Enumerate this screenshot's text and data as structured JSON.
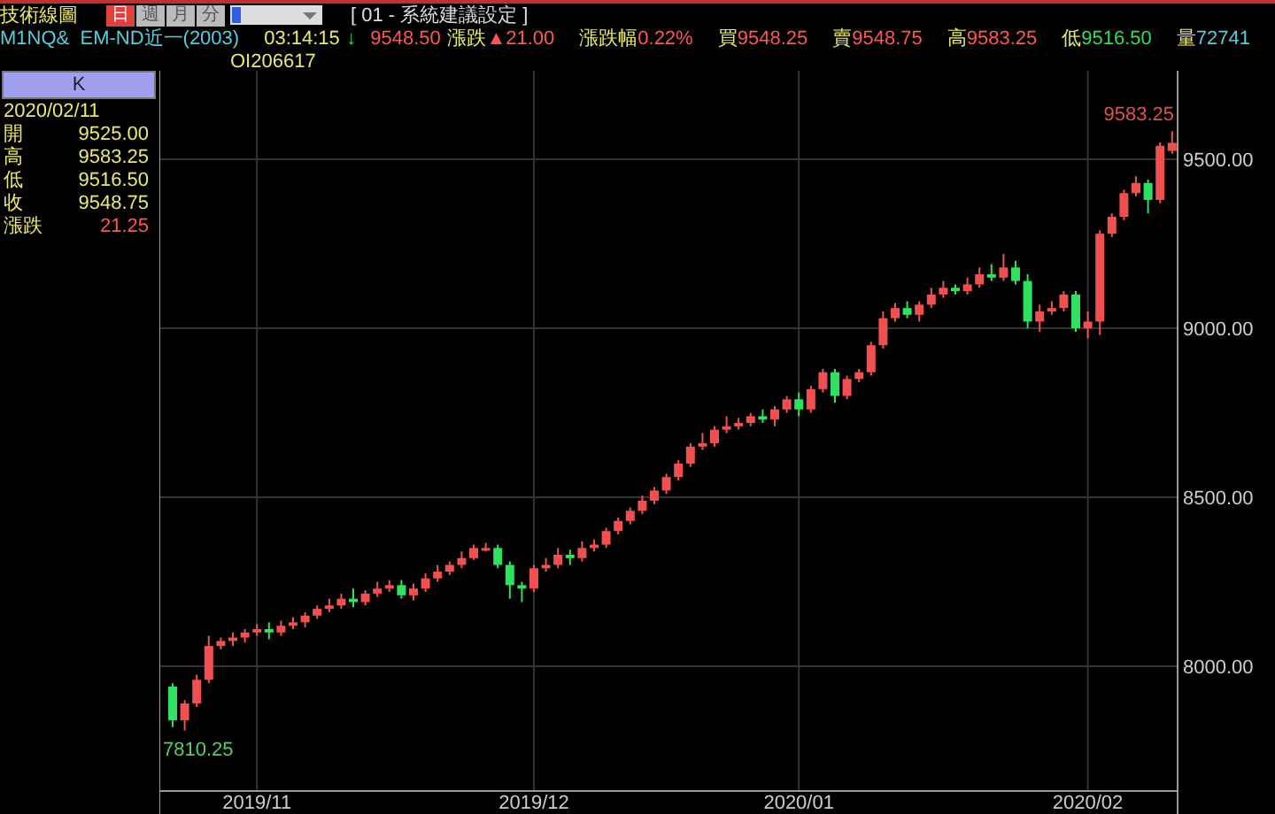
{
  "toolbar": {
    "title": "技術線圖",
    "periods": [
      {
        "label": "日",
        "selected": true
      },
      {
        "label": "週",
        "selected": false
      },
      {
        "label": "月",
        "selected": false
      },
      {
        "label": "分",
        "selected": false
      }
    ],
    "settings": "[ 01 - 系統建議設定 ]"
  },
  "quote": {
    "symbol": "M1NQ&  EM-ND近一(2003)",
    "time": "03:14:15",
    "arrow": "↓",
    "price": "9548.50",
    "items": [
      {
        "label": "漲跌",
        "value": "▲21.00",
        "color": "#ff5555"
      },
      {
        "label": "漲跌幅",
        "value": "0.22%",
        "color": "#ff5555"
      },
      {
        "label": "買",
        "value": "9548.25",
        "color": "#ff5555"
      },
      {
        "label": "賣",
        "value": "9548.75",
        "color": "#ff5555"
      },
      {
        "label": "高",
        "value": "9583.25",
        "color": "#ff5555"
      },
      {
        "label": "低",
        "value": "9516.50",
        "color": "#33dd55"
      },
      {
        "label": "量",
        "value": "72741",
        "color": "#55ccdd"
      }
    ],
    "oi": "OI206617"
  },
  "info": {
    "header": "K",
    "date": "2020/02/11",
    "rows": [
      {
        "label": "開",
        "value": "9525.00",
        "color": "#e8e870"
      },
      {
        "label": "高",
        "value": "9583.25",
        "color": "#e8e870"
      },
      {
        "label": "低",
        "value": "9516.50",
        "color": "#e8e870"
      },
      {
        "label": "收",
        "value": "9548.75",
        "color": "#e8e870"
      },
      {
        "label": "漲跌",
        "value": "21.25",
        "color": "#ff5555"
      }
    ]
  },
  "chart": {
    "high_label": "9583.25",
    "low_label": "7810.25",
    "chart_data": {
      "type": "candlestick",
      "yticks": [
        {
          "value": 9500,
          "label": "9500.00"
        },
        {
          "value": 9000,
          "label": "9000.00"
        },
        {
          "value": 8500,
          "label": "8500.00"
        },
        {
          "value": 8000,
          "label": "8000.00"
        }
      ],
      "ylim": [
        7631,
        9762
      ],
      "grid": true,
      "categories": [
        null,
        null,
        null,
        null,
        null,
        null,
        null,
        "2019/11",
        null,
        null,
        null,
        null,
        null,
        null,
        null,
        null,
        null,
        null,
        null,
        null,
        null,
        null,
        null,
        null,
        null,
        null,
        null,
        null,
        null,
        null,
        "2019/12",
        null,
        null,
        null,
        null,
        null,
        null,
        null,
        null,
        null,
        null,
        null,
        null,
        null,
        null,
        null,
        null,
        null,
        null,
        null,
        null,
        null,
        "2020/01",
        null,
        null,
        null,
        null,
        null,
        null,
        null,
        null,
        null,
        null,
        null,
        null,
        null,
        null,
        null,
        null,
        null,
        null,
        null,
        null,
        null,
        null,
        null,
        "2020/02",
        null,
        null,
        null,
        null,
        null,
        null,
        null
      ],
      "ohlc": [
        [
          7940,
          7950,
          7820,
          7840
        ],
        [
          7840,
          7900,
          7810,
          7890
        ],
        [
          7890,
          7975,
          7880,
          7960
        ],
        [
          7960,
          8090,
          7950,
          8060
        ],
        [
          8060,
          8085,
          8050,
          8075
        ],
        [
          8075,
          8100,
          8060,
          8085
        ],
        [
          8085,
          8110,
          8070,
          8100
        ],
        [
          8100,
          8125,
          8090,
          8110
        ],
        [
          8110,
          8130,
          8080,
          8100
        ],
        [
          8100,
          8135,
          8090,
          8120
        ],
        [
          8120,
          8145,
          8110,
          8130
        ],
        [
          8130,
          8160,
          8115,
          8150
        ],
        [
          8150,
          8180,
          8140,
          8170
        ],
        [
          8170,
          8200,
          8160,
          8180
        ],
        [
          8180,
          8215,
          8170,
          8200
        ],
        [
          8200,
          8230,
          8175,
          8190
        ],
        [
          8190,
          8225,
          8180,
          8215
        ],
        [
          8215,
          8250,
          8205,
          8230
        ],
        [
          8230,
          8255,
          8220,
          8240
        ],
        [
          8240,
          8255,
          8200,
          8210
        ],
        [
          8210,
          8245,
          8195,
          8230
        ],
        [
          8230,
          8275,
          8220,
          8260
        ],
        [
          8260,
          8300,
          8250,
          8280
        ],
        [
          8280,
          8310,
          8270,
          8300
        ],
        [
          8300,
          8340,
          8290,
          8320
        ],
        [
          8320,
          8360,
          8315,
          8350
        ],
        [
          8350,
          8365,
          8340,
          8350
        ],
        [
          8350,
          8360,
          8290,
          8300
        ],
        [
          8300,
          8310,
          8200,
          8240
        ],
        [
          8240,
          8250,
          8190,
          8230
        ],
        [
          8230,
          8300,
          8220,
          8290
        ],
        [
          8290,
          8320,
          8280,
          8300
        ],
        [
          8300,
          8350,
          8290,
          8330
        ],
        [
          8330,
          8345,
          8300,
          8320
        ],
        [
          8320,
          8370,
          8310,
          8350
        ],
        [
          8350,
          8375,
          8340,
          8360
        ],
        [
          8360,
          8410,
          8350,
          8400
        ],
        [
          8400,
          8440,
          8390,
          8430
        ],
        [
          8430,
          8470,
          8420,
          8460
        ],
        [
          8460,
          8505,
          8450,
          8490
        ],
        [
          8490,
          8530,
          8480,
          8520
        ],
        [
          8520,
          8570,
          8510,
          8560
        ],
        [
          8560,
          8610,
          8550,
          8600
        ],
        [
          8600,
          8660,
          8590,
          8650
        ],
        [
          8650,
          8690,
          8640,
          8660
        ],
        [
          8660,
          8710,
          8650,
          8700
        ],
        [
          8700,
          8740,
          8690,
          8710
        ],
        [
          8710,
          8735,
          8700,
          8720
        ],
        [
          8720,
          8750,
          8710,
          8740
        ],
        [
          8740,
          8760,
          8720,
          8730
        ],
        [
          8730,
          8770,
          8710,
          8760
        ],
        [
          8760,
          8800,
          8750,
          8790
        ],
        [
          8790,
          8810,
          8740,
          8760
        ],
        [
          8760,
          8830,
          8750,
          8820
        ],
        [
          8820,
          8880,
          8810,
          8870
        ],
        [
          8870,
          8880,
          8780,
          8800
        ],
        [
          8800,
          8860,
          8790,
          8850
        ],
        [
          8850,
          8880,
          8840,
          8870
        ],
        [
          8870,
          8960,
          8860,
          8950
        ],
        [
          8950,
          9050,
          8940,
          9030
        ],
        [
          9030,
          9075,
          9020,
          9060
        ],
        [
          9060,
          9080,
          9030,
          9040
        ],
        [
          9040,
          9080,
          9020,
          9070
        ],
        [
          9070,
          9120,
          9060,
          9100
        ],
        [
          9100,
          9140,
          9090,
          9120
        ],
        [
          9120,
          9130,
          9100,
          9110
        ],
        [
          9110,
          9150,
          9100,
          9130
        ],
        [
          9130,
          9180,
          9120,
          9160
        ],
        [
          9160,
          9190,
          9140,
          9150
        ],
        [
          9150,
          9220,
          9140,
          9180
        ],
        [
          9180,
          9200,
          9130,
          9140
        ],
        [
          9140,
          9160,
          9000,
          9020
        ],
        [
          9020,
          9070,
          8990,
          9050
        ],
        [
          9050,
          9080,
          9040,
          9060
        ],
        [
          9060,
          9110,
          9050,
          9100
        ],
        [
          9100,
          9110,
          8990,
          9000
        ],
        [
          9000,
          9050,
          8970,
          9020
        ],
        [
          9020,
          9290,
          8980,
          9280
        ],
        [
          9280,
          9340,
          9270,
          9330
        ],
        [
          9330,
          9410,
          9320,
          9400
        ],
        [
          9400,
          9450,
          9390,
          9430
        ],
        [
          9430,
          9440,
          9340,
          9380
        ],
        [
          9380,
          9550,
          9370,
          9540
        ],
        [
          9525,
          9583.25,
          9516.5,
          9548.75
        ]
      ]
    }
  }
}
